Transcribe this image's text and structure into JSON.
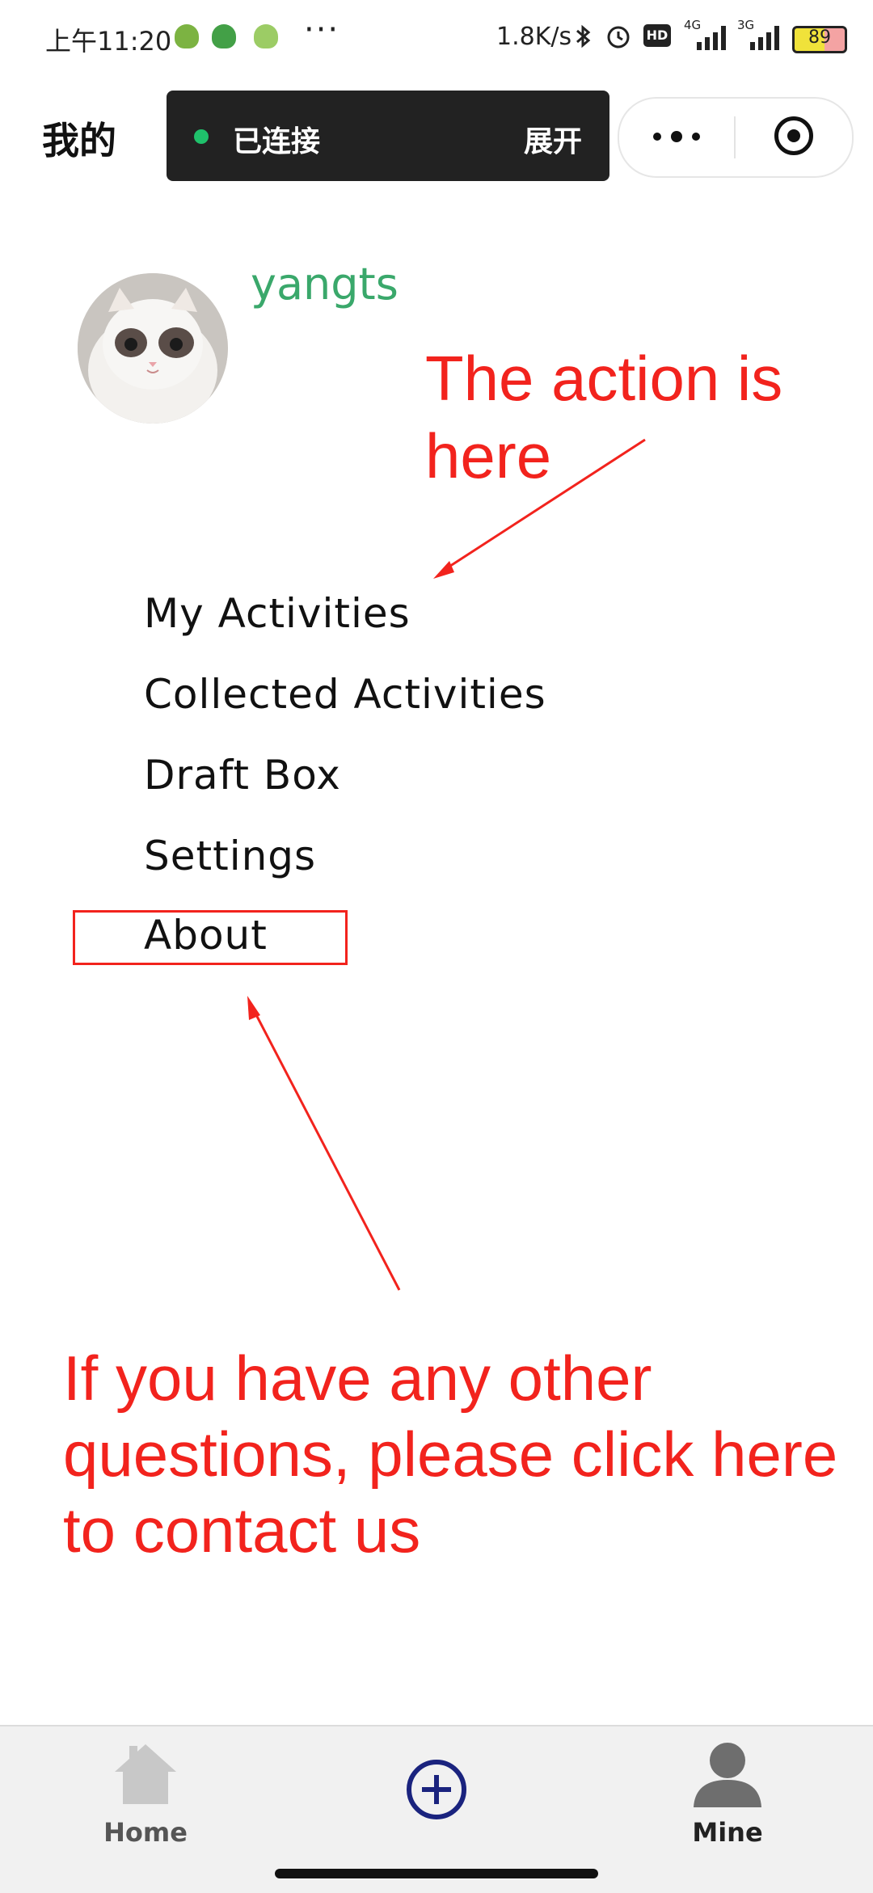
{
  "status_bar": {
    "time": "上午11:20",
    "more": "···",
    "net_speed": "1.8K/s",
    "hd_label": "HD",
    "net_4g": "4G",
    "net_3g": "3G",
    "battery": "89",
    "icons": [
      "app-notification-icon",
      "app-notification-icon",
      "app-notification-icon",
      "bluetooth-icon",
      "alarm-icon",
      "hd-icon",
      "signal-4g-icon",
      "signal-3g-icon",
      "battery-icon"
    ]
  },
  "header": {
    "title": "我的",
    "connection_status": "已连接",
    "expand_label": "展开",
    "connection_color": "#1fc16b"
  },
  "profile": {
    "username": "yangts",
    "username_color": "#3aa86b",
    "avatar": "cat-avatar"
  },
  "menu": {
    "items": [
      {
        "label": "My Activities"
      },
      {
        "label": "Collected Activities"
      },
      {
        "label": "Draft Box"
      },
      {
        "label": "Settings"
      },
      {
        "label": "About"
      }
    ]
  },
  "annotations": {
    "top_note": "The action is here",
    "bottom_note": "If you have any other questions, please click here to contact us",
    "color": "#f2231d"
  },
  "tab_bar": {
    "tabs": [
      {
        "label": "Home",
        "icon": "home-icon",
        "active": false
      },
      {
        "label": "",
        "icon": "add-circle-icon",
        "active": false
      },
      {
        "label": "Mine",
        "icon": "user-icon",
        "active": true
      }
    ],
    "accent": "#1a237e"
  }
}
